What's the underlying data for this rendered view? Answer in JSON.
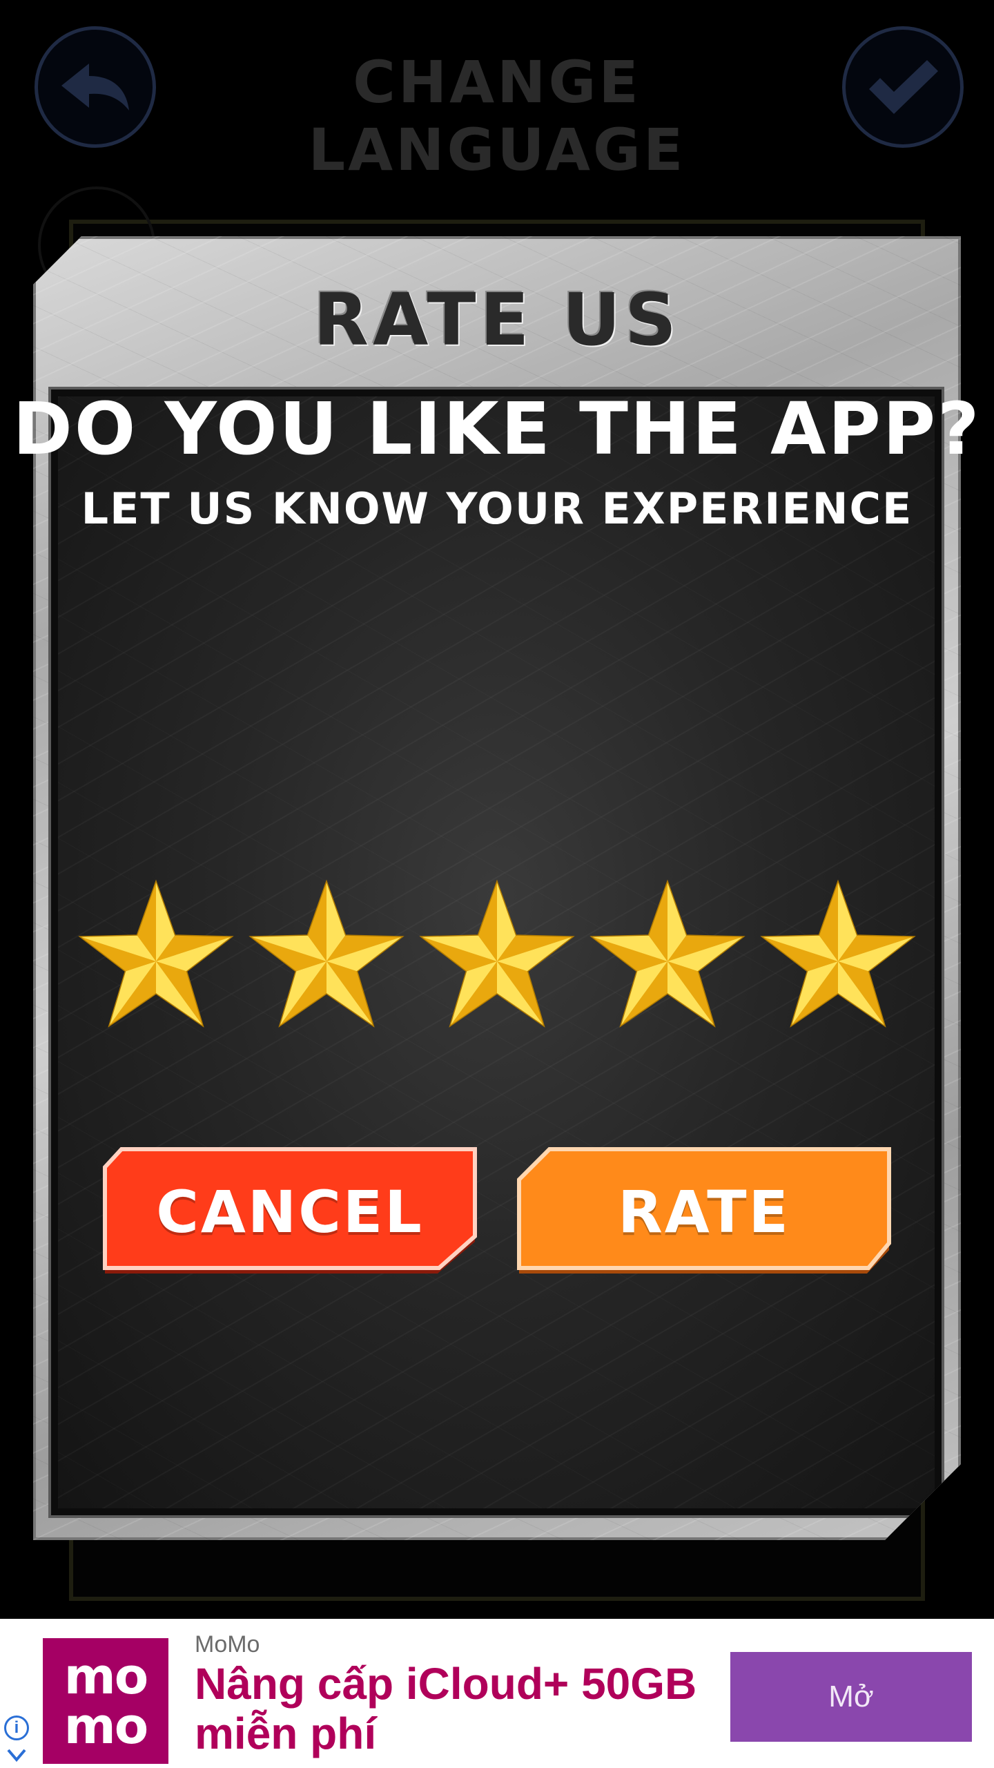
{
  "topbar": {
    "title": "CHANGE LANGUAGE",
    "back_icon": "back-arrow-icon",
    "confirm_icon": "checkmark-icon"
  },
  "dialog": {
    "title": "RATE US",
    "question": "DO YOU LIKE THE APP?",
    "subtitle": "LET US KNOW YOUR EXPERIENCE",
    "rating": {
      "value": 5,
      "max": 5
    },
    "cancel_label": "CANCEL",
    "rate_label": "RATE",
    "colors": {
      "cancel": "#ff3c1a",
      "rate": "#ff8a1a",
      "star": "#f7c41a"
    }
  },
  "ad": {
    "brand": "MoMo",
    "logo_line1": "mo",
    "logo_line2": "mo",
    "headline": "Nâng cấp iCloud+ 50GB miễn phí",
    "cta": "Mở",
    "info_icon": "info-icon",
    "colors": {
      "logo": "#a50064",
      "cta": "#8a47ad"
    }
  }
}
